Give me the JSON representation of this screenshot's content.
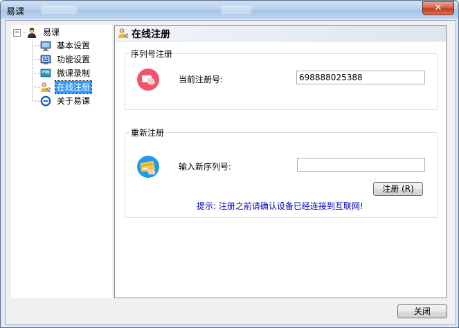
{
  "window": {
    "title": "易课",
    "close_glyph": "✕"
  },
  "tree": {
    "root": "易课",
    "expander": "−",
    "items": [
      {
        "label": "基本设置",
        "icon": "monitor-icon"
      },
      {
        "label": "功能设置",
        "icon": "settings-screen-icon"
      },
      {
        "label": "微课录制",
        "icon": "recording-icon"
      },
      {
        "label": "在线注册",
        "icon": "user-register-icon",
        "selected": true
      },
      {
        "label": "关于易课",
        "icon": "about-icon"
      }
    ]
  },
  "panel": {
    "title": "在线注册",
    "serial_group": {
      "title": "序列号注册",
      "current_label": "当前注册号:",
      "current_value": "698888025388"
    },
    "reregister_group": {
      "title": "重新注册",
      "new_serial_label": "输入新序列号:",
      "new_serial_value": "",
      "register_button": "注册 (R)",
      "hint": "提示: 注册之前请确认设备已经连接到互联网!"
    }
  },
  "footer": {
    "close_button": "关闭"
  },
  "colors": {
    "accent_selected": "#3399ff",
    "hint_text": "#0000c0",
    "title_close": "#c23b22"
  }
}
